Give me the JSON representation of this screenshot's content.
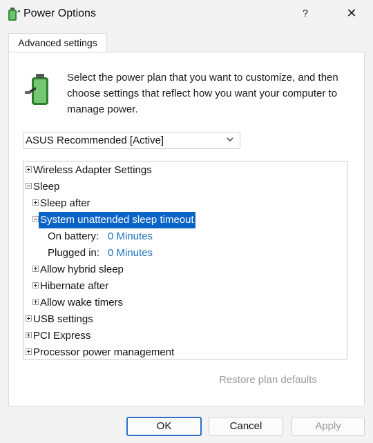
{
  "window": {
    "title": "Power Options",
    "help_label": "?",
    "close_label": "✕"
  },
  "tab": {
    "label": "Advanced settings"
  },
  "description": "Select the power plan that you want to customize, and then choose settings that reflect how you want your computer to manage power.",
  "plan_select": {
    "selected": "ASUS Recommended [Active]"
  },
  "tree": {
    "wireless": "Wireless Adapter Settings",
    "sleep": "Sleep",
    "sleep_after": "Sleep after",
    "unattended": "System unattended sleep timeout",
    "on_battery_label": "On battery:",
    "on_battery_value": "0 Minutes",
    "plugged_in_label": "Plugged in:",
    "plugged_in_value": "0 Minutes",
    "hybrid_sleep": "Allow hybrid sleep",
    "hibernate_after": "Hibernate after",
    "wake_timers": "Allow wake timers",
    "usb": "USB settings",
    "pci": "PCI Express",
    "processor": "Processor power management"
  },
  "buttons": {
    "restore": "Restore plan defaults",
    "ok": "OK",
    "cancel": "Cancel",
    "apply": "Apply"
  },
  "icons": {
    "app": "power-options-icon",
    "battery": "battery-plug-icon",
    "chevron": "chevron-down-icon"
  },
  "colors": {
    "selection": "#0a64c8",
    "link_value": "#1a6fc4",
    "ok_border": "#2a6fc9"
  }
}
